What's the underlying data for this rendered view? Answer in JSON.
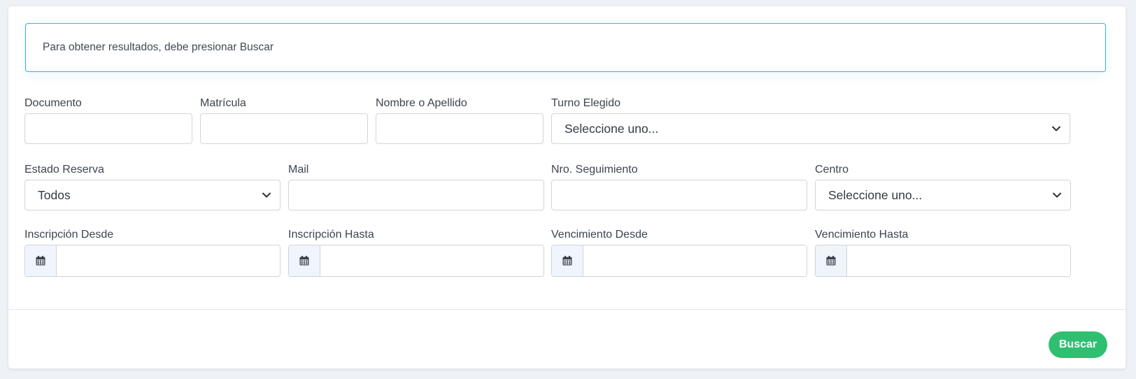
{
  "alert": {
    "message": "Para obtener resultados, debe presionar Buscar",
    "border_color": "#29b6e8"
  },
  "filters": {
    "documento": {
      "label": "Documento",
      "value": ""
    },
    "matricula": {
      "label": "Matrícula",
      "value": ""
    },
    "nombre": {
      "label": "Nombre o Apellido",
      "value": ""
    },
    "turno": {
      "label": "Turno Elegido",
      "selected": "Seleccione uno..."
    },
    "estado": {
      "label": "Estado Reserva",
      "selected": "Todos"
    },
    "mail": {
      "label": "Mail",
      "value": ""
    },
    "seguimiento": {
      "label": "Nro. Seguimiento",
      "value": ""
    },
    "centro": {
      "label": "Centro",
      "selected": "Seleccione uno..."
    },
    "inscripcion_desde": {
      "label": "Inscripción Desde",
      "value": "",
      "icon": "calendar-icon"
    },
    "inscripcion_hasta": {
      "label": "Inscripción Hasta",
      "value": "",
      "icon": "calendar-icon"
    },
    "vencimiento_desde": {
      "label": "Vencimiento Desde",
      "value": "",
      "icon": "calendar-icon"
    },
    "vencimiento_hasta": {
      "label": "Vencimiento Hasta",
      "value": "",
      "icon": "calendar-icon"
    }
  },
  "actions": {
    "search_label": "Buscar",
    "search_color": "#2fbf71"
  }
}
